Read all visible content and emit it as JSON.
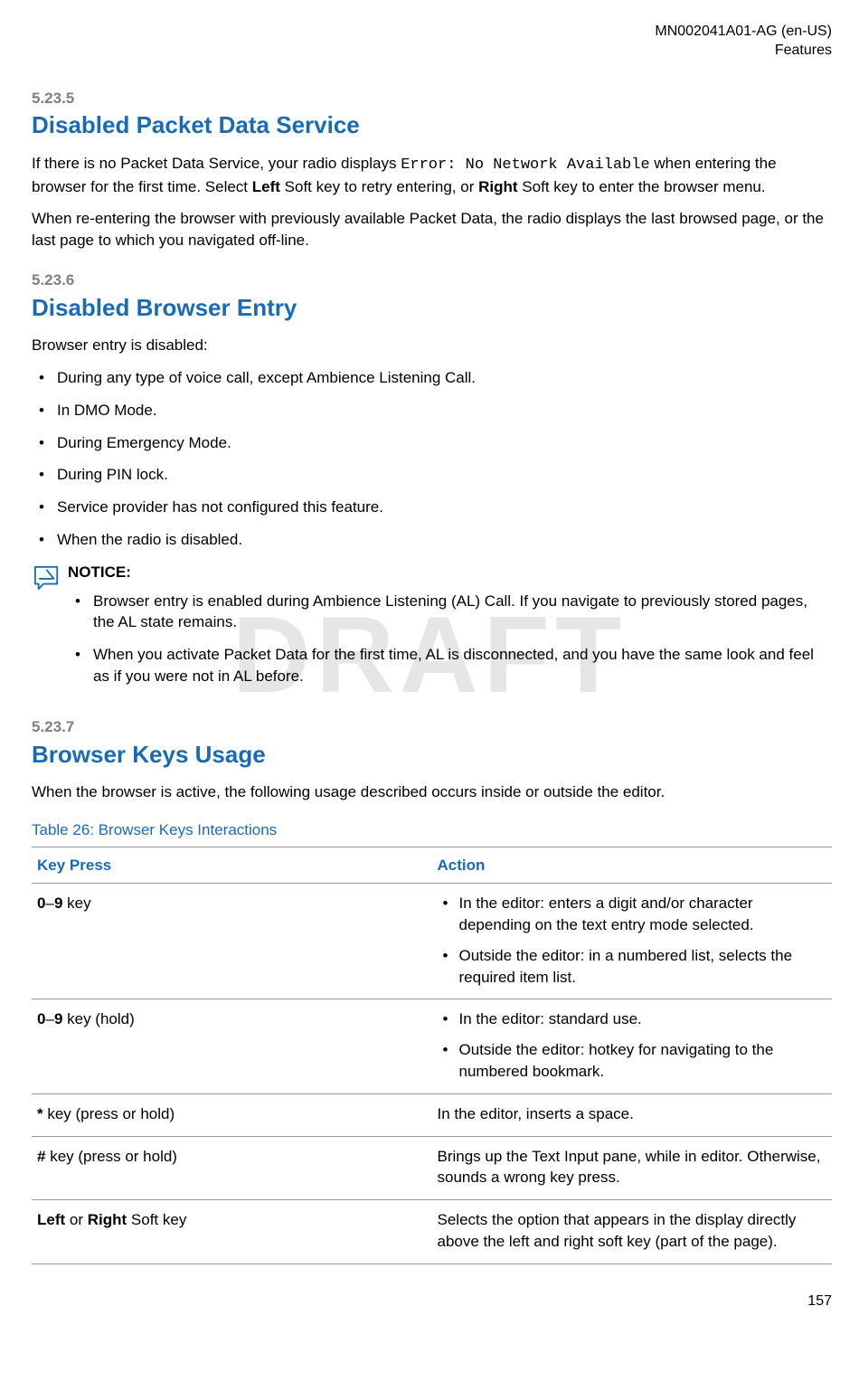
{
  "header": {
    "doc_id": "MN002041A01-AG (en-US)",
    "section": "Features"
  },
  "watermark": "DRAFT",
  "sections": {
    "s1": {
      "num": "5.23.5",
      "title": "Disabled Packet Data Service",
      "p1_a": "If there is no Packet Data Service, your radio displays ",
      "p1_code": "Error: No Network Available",
      "p1_b": " when entering the browser for the first time. Select ",
      "p1_left": "Left",
      "p1_c": " Soft key to retry entering, or ",
      "p1_right": "Right",
      "p1_d": " Soft key to enter the browser menu.",
      "p2": "When re-entering the browser with previously available Packet Data, the radio displays the last browsed page, or the last page to which you navigated off-line."
    },
    "s2": {
      "num": "5.23.6",
      "title": "Disabled Browser Entry",
      "intro": "Browser entry is disabled:",
      "items": [
        "During any type of voice call, except Ambience Listening Call.",
        "In DMO Mode.",
        "During Emergency Mode.",
        "During PIN lock.",
        "Service provider has not configured this feature.",
        "When the radio is disabled."
      ],
      "notice_label": "NOTICE:",
      "notice_items": [
        "Browser entry is enabled during Ambience Listening (AL) Call. If you navigate to previously stored pages, the AL state remains.",
        "When you activate Packet Data for the first time, AL is disconnected, and you have the same look and feel as if you were not in AL before."
      ]
    },
    "s3": {
      "num": "5.23.7",
      "title": "Browser Keys Usage",
      "intro": "When the browser is active, the following usage described occurs inside or outside the editor."
    }
  },
  "table": {
    "title": "Table 26: Browser Keys Interactions",
    "h1": "Key Press",
    "h2": "Action",
    "r1": {
      "k_a": "0",
      "k_dash": "–",
      "k_b": "9",
      "k_suffix": " key",
      "a1": "In the editor: enters a digit and/or character depending on the text entry mode selected.",
      "a2": "Outside the editor: in a numbered list, selects the required item list."
    },
    "r2": {
      "k_a": "0",
      "k_dash": "–",
      "k_b": "9",
      "k_suffix": " key (hold)",
      "a1": "In the editor: standard use.",
      "a2": "Outside the editor: hotkey for navigating to the numbered bookmark."
    },
    "r3": {
      "k_a": "*",
      "k_suffix": " key (press or hold)",
      "action": "In the editor, inserts a space."
    },
    "r4": {
      "k_a": "#",
      "k_suffix": " key (press or hold)",
      "action": "Brings up the Text Input pane, while in editor. Otherwise, sounds a wrong key press."
    },
    "r5": {
      "k_left": "Left",
      "k_or": " or ",
      "k_right": "Right",
      "k_suffix": " Soft key",
      "action": "Selects the option that appears in the display directly above the left and right soft key (part of the page)."
    }
  },
  "page_num": "157"
}
